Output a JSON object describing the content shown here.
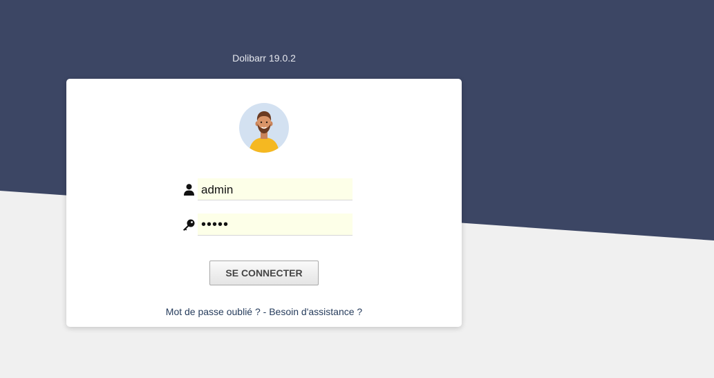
{
  "app": {
    "version_text": "Dolibarr 19.0.2"
  },
  "login": {
    "username_value": "admin",
    "password_value": "•••••",
    "submit_label": "SE CONNECTER",
    "forgot_password_label": "Mot de passe oublié ?",
    "separator": " - ",
    "help_label": "Besoin d'assistance ?"
  },
  "icons": {
    "username": "user-icon",
    "password": "key-icon",
    "avatar": "avatar-illustration"
  },
  "colors": {
    "header_bg": "#3c4664",
    "page_bg": "#f0f0f0",
    "input_bg": "#fdffe8",
    "link": "#263c5c"
  }
}
